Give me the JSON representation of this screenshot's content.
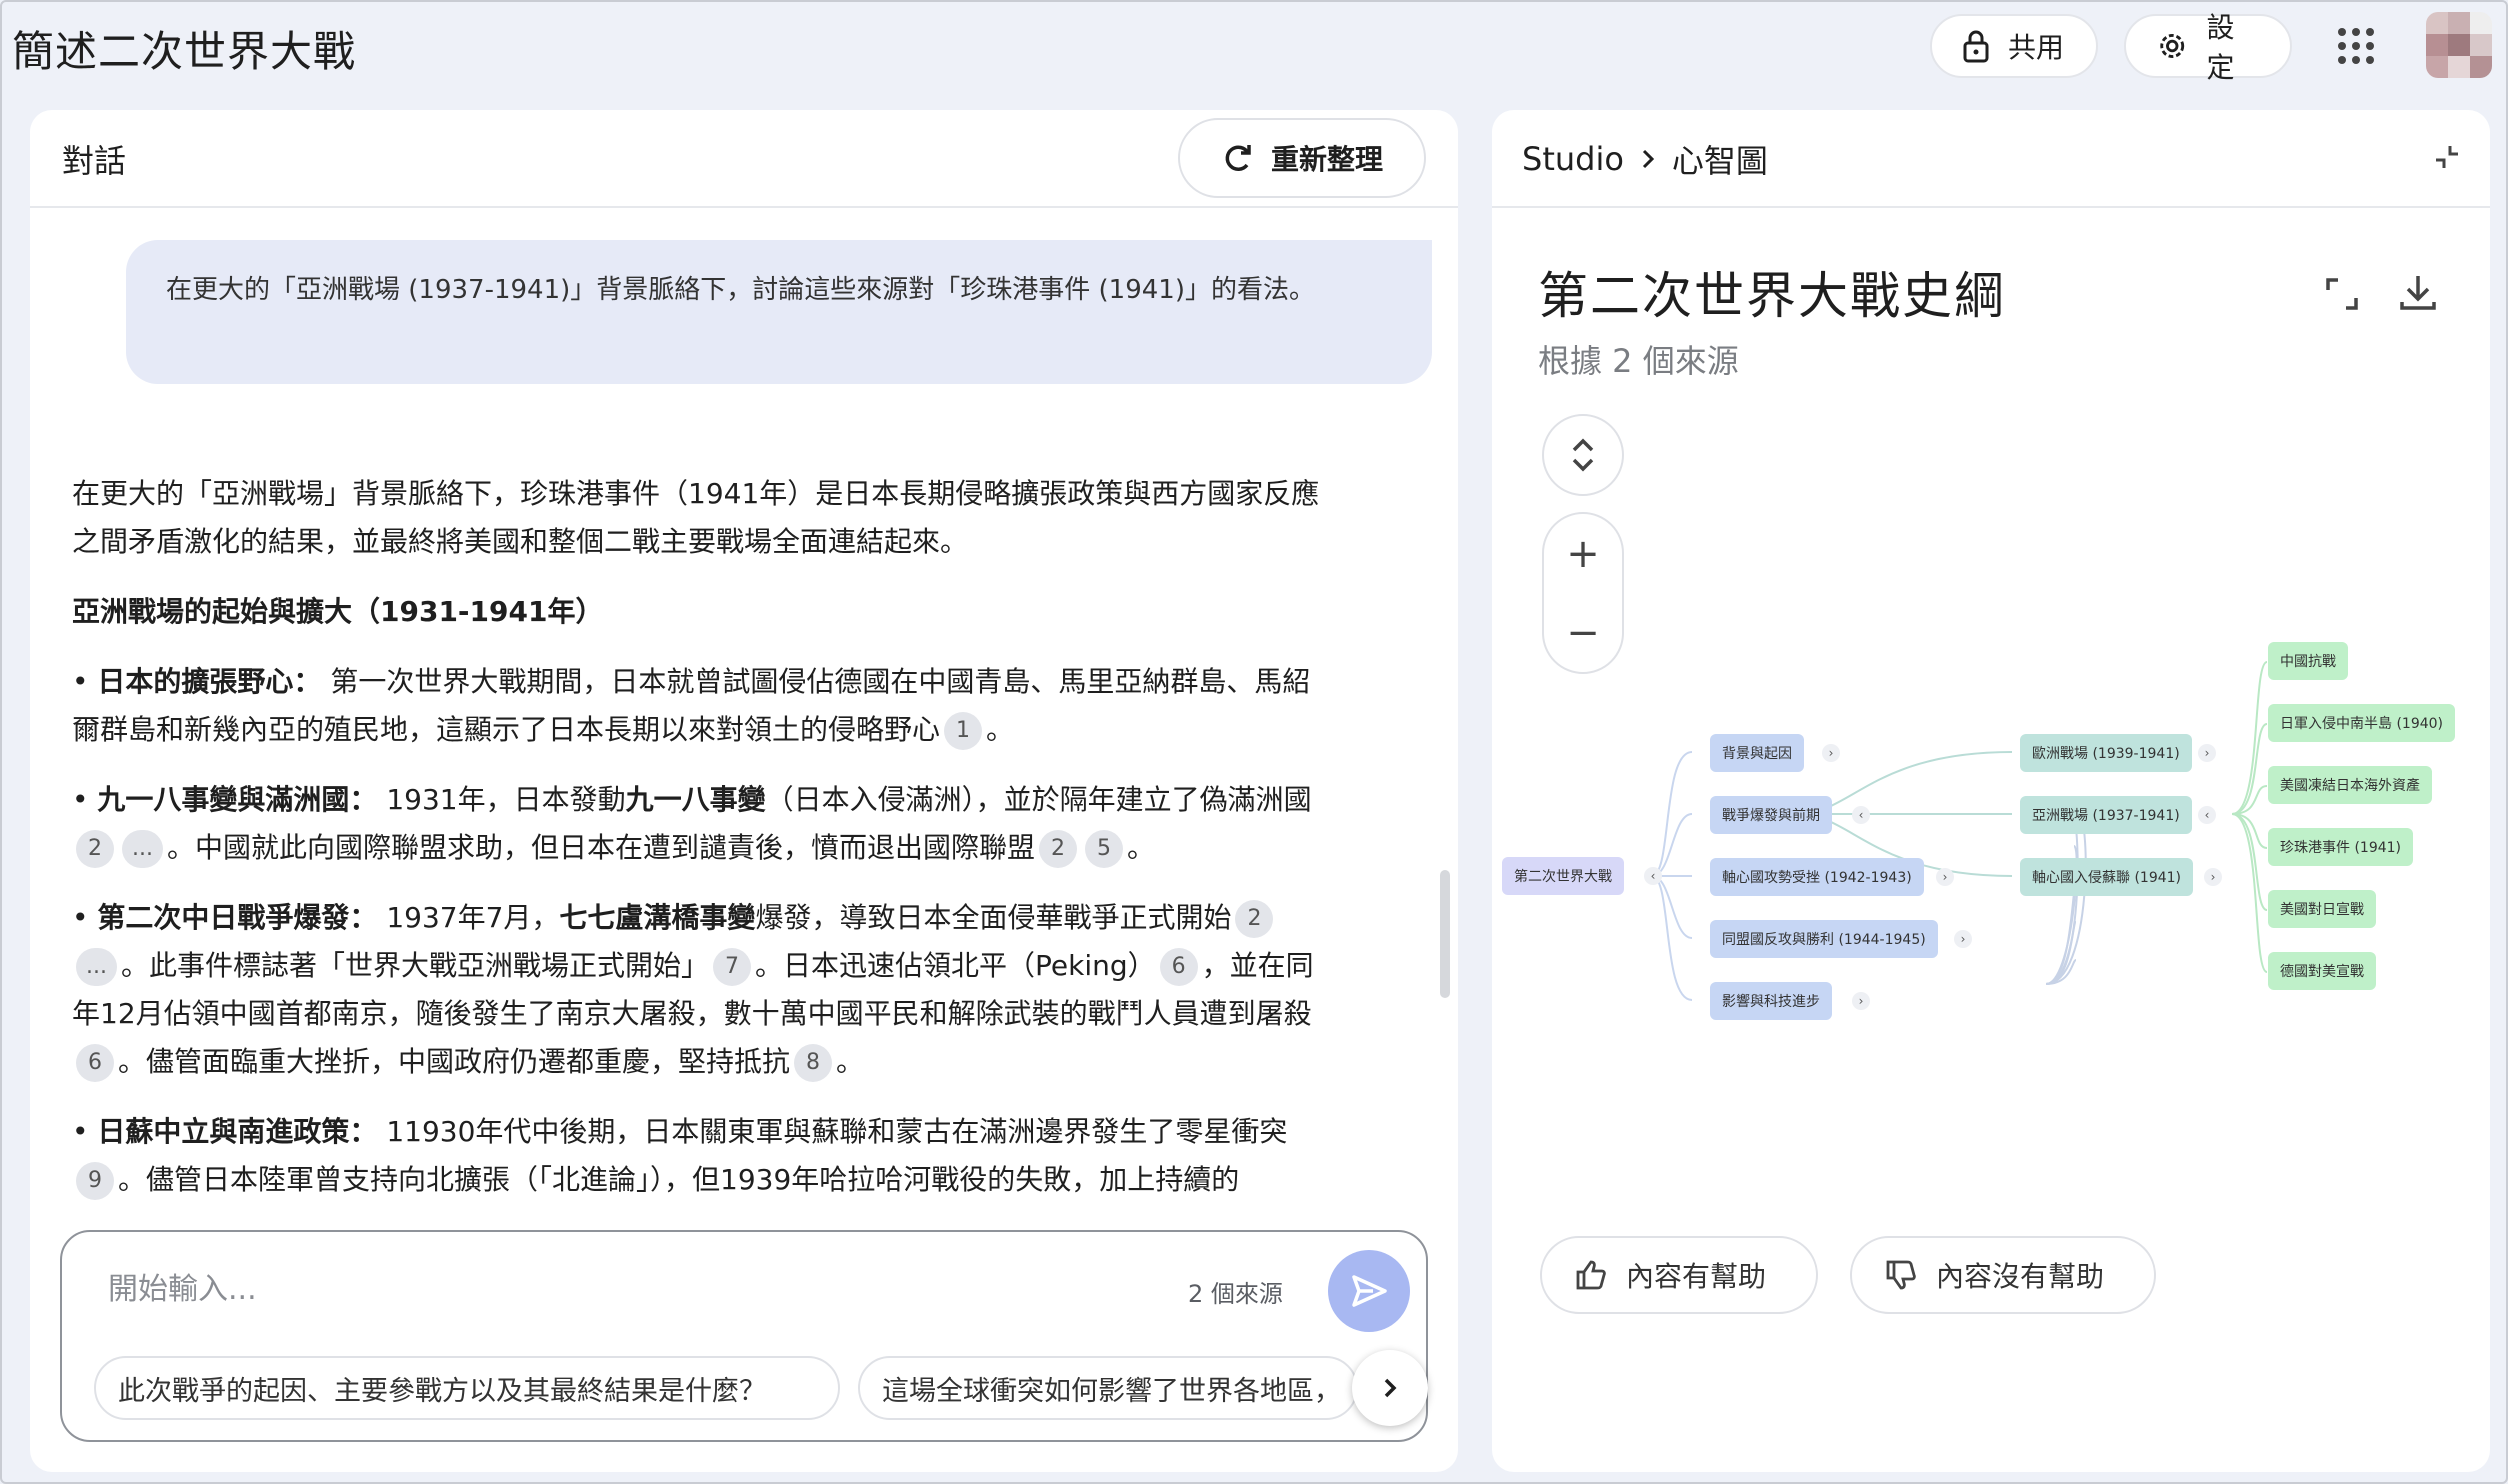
{
  "app": {
    "title": "簡述二次世界大戰",
    "share_label": "共用",
    "settings_label": "設定"
  },
  "chat": {
    "header_title": "對話",
    "refresh_label": "重新整理",
    "user_message": "在更大的「亞洲戰場 (1937-1941)」背景脈絡下，討論這些來源對「珍珠港事件 (1941)」的看法。",
    "answer": {
      "intro": "在更大的「亞洲戰場」背景脈絡下，珍珠港事件（1941年）是日本長期侵略擴張政策與西方國家反應之間矛盾激化的結果，並最終將美國和整個二戰主要戰場全面連結起來。",
      "section_heading": "亞洲戰場的起始與擴大（1931-1941年）",
      "b1_title": "日本的擴張野心：",
      "b1_text": "第一次世界大戰期間，日本就曾試圖侵佔德國在中國青島、馬里亞納群島、馬紹爾群島和新幾內亞的殖民地，這顯示了日本長期以來對領土的侵略野心",
      "b1_cite": "1",
      "b2_title": "九一八事變與滿洲國：",
      "b2_text_a": "1931年，日本發動",
      "b2_bold": "九一八事變",
      "b2_text_b": "（日本入侵滿洲），並於隔年建立了偽滿洲國",
      "b2_cite_a": "2",
      "b2_cite_b": "...",
      "b2_text_c": "。中國就此向國際聯盟求助，但日本在遭到譴責後，憤而退出國際聯盟",
      "b2_cite_c": "2",
      "b2_cite_d": "5",
      "b3_title": "第二次中日戰爭爆發：",
      "b3_text_a": "1937年7月，",
      "b3_bold": "七七盧溝橋事變",
      "b3_text_b": "爆發，導致日本全面侵華戰爭正式開始",
      "b3_cite_a": "2",
      "b3_cite_b": "...",
      "b3_text_c": "。此事件標誌著「世界大戰亞洲戰場正式開始」",
      "b3_cite_c": "7",
      "b3_text_d": "。日本迅速佔領北平（Peking）",
      "b3_cite_d": "6",
      "b3_text_e": "，並在同年12月佔領中國首都南京，隨後發生了南京大屠殺，數十萬中國平民和解除武裝的戰鬥人員遭到屠殺",
      "b3_cite_e": "6",
      "b3_text_f": "。儘管面臨重大挫折，中國政府仍遷都重慶，堅持抵抗",
      "b3_cite_f": "8",
      "b4_title": "日蘇中立與南進政策：",
      "b4_text_a": "11930年代中後期，日本關東軍與蘇聯和蒙古在滿洲邊界發生了零星衝突",
      "b4_cite_a": "9",
      "b4_text_b": "。儘管日本陸軍曾支持向北擴張（「北進論」），但1939年哈拉哈河戰役的失敗，加上持續的"
    },
    "input": {
      "placeholder": "開始輸入...",
      "source_count": "2 個來源"
    },
    "suggestions": [
      "此次戰爭的起因、主要參戰方以及其最終結果是什麼？",
      "這場全球衝突如何影響了世界各地區，"
    ]
  },
  "studio": {
    "crumb_root": "Studio",
    "crumb_current": "心智圖",
    "title": "第二次世界大戰史綱",
    "subtitle": "根據 2 個來源",
    "mindmap": {
      "root": "第二次世界大戰",
      "level1": [
        "背景與起因",
        "戰爭爆發與前期",
        "軸心國攻勢受挫 (1942-1943)",
        "同盟國反攻與勝利 (1944-1945)",
        "影響與科技進步"
      ],
      "level2": [
        "歐洲戰場 (1939-1941)",
        "亞洲戰場 (1937-1941)",
        "軸心國入侵蘇聯 (1941)"
      ],
      "level3": [
        "中國抗戰",
        "日軍入侵中南半島 (1940)",
        "美國凍結日本海外資產",
        "珍珠港事件 (1941)",
        "美國對日宣戰",
        "德國對美宣戰"
      ]
    },
    "helpful_label": "內容有幫助",
    "not_helpful_label": "內容沒有幫助"
  }
}
